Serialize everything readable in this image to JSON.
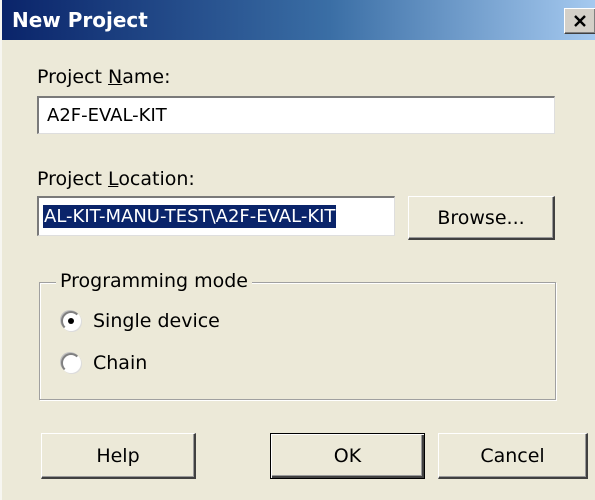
{
  "window": {
    "title": "New Project",
    "close_symbol": "X"
  },
  "project_name": {
    "label_pre": "Project ",
    "label_accel": "N",
    "label_post": "ame:",
    "value": "A2F-EVAL-KIT"
  },
  "project_location": {
    "label_pre": "Project ",
    "label_accel": "L",
    "label_post": "ocation:",
    "value": "AL-KIT-MANU-TEST\\A2F-EVAL-KIT"
  },
  "browse_button": {
    "label": "Browse..."
  },
  "programming_mode": {
    "legend": "Programming mode",
    "options": [
      {
        "label": "Single device",
        "selected": true
      },
      {
        "label": "Chain",
        "selected": false
      }
    ]
  },
  "buttons": {
    "help": "Help",
    "ok": "OK",
    "cancel": "Cancel"
  },
  "colors": {
    "titlebar_start": "#0a246a",
    "titlebar_end": "#a6caf0",
    "dialog_face": "#ece9d8",
    "selection": "#0a246a"
  },
  "icons": {
    "close": "close-icon",
    "radio": "radio-button-icon"
  }
}
